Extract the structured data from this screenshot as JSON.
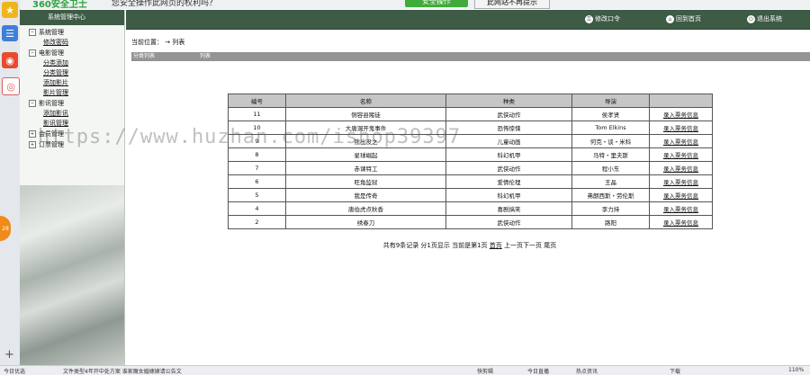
{
  "notify": {
    "logo": "360安全卫士",
    "message": "您安全操作此网页的权利吗？",
    "action_button": "安全操作",
    "dismiss_button": "此网站不再提示"
  },
  "sidebar": {
    "title": "系统管理中心",
    "groups": [
      {
        "label": "系统管理",
        "toggle": "⊟",
        "items": [
          "修改密码"
        ]
      },
      {
        "label": "电影管理",
        "toggle": "⊟",
        "items": [
          "分类添加",
          "分类管理",
          "添加影片",
          "影片管理"
        ]
      },
      {
        "label": "影讯管理",
        "toggle": "⊟",
        "items": [
          "添加影讯",
          "影讯管理"
        ]
      },
      {
        "label": "会员管理",
        "toggle": "⊞",
        "items": []
      },
      {
        "label": "订票管理",
        "toggle": "⊞",
        "items": []
      }
    ]
  },
  "topbar": {
    "change_password": "修改口令",
    "home": "回到首页",
    "logout": "退出系统"
  },
  "breadcrumb": "当前位置：  → 列表",
  "section": {
    "left": "分类列表",
    "right": "列表"
  },
  "table": {
    "headers": [
      "编号",
      "名称",
      "种类",
      "导演",
      ""
    ],
    "rows": [
      [
        "11",
        "侧容县赌徒",
        "武侠动作",
        "侯孝贤",
        "录入票务信息"
      ],
      [
        "10",
        "大唐洞开鬼事件",
        "恐怖惊悚",
        "Tom Elkins",
        "录入票务信息"
      ],
      [
        "9",
        "熊出没之",
        "儿童动画",
        "何克・谈・米科",
        "录入票务信息"
      ],
      [
        "8",
        "星球崛起",
        "科幻机甲",
        "马特・里夫斯",
        "录入票务信息"
      ],
      [
        "7",
        "赤课特工",
        "武侠动作",
        "程小东",
        "录入票务信息"
      ],
      [
        "6",
        "旺角监狱",
        "爱情伦理",
        "王晶",
        "录入票务信息"
      ],
      [
        "5",
        "我是传奇",
        "科幻机甲",
        "弗朗西斯・劳伦斯",
        "录入票务信息"
      ],
      [
        "4",
        "唐伯虎点秋香",
        "喜剧搞笑",
        "李力持",
        "录入票务信息"
      ],
      [
        "2",
        "绣春刀",
        "武侠动作",
        "路阳",
        "录入票务信息"
      ]
    ]
  },
  "pager": {
    "summary": "共有9条记录  分1页显示  当前是第1页",
    "first": "首页",
    "rest": "上一页下一页  尾页"
  },
  "watermark": "https://www.huzhan.com/ishop39397",
  "statusbar": {
    "left": "今日优选",
    "news": "文件类型4年开中处方案 谁家魔女婚嫁嫁请公告文",
    "right_items": [
      "快剪辑",
      "今日直播",
      "热点资讯",
      "下载",
      "110%"
    ]
  },
  "dock": {
    "side_badge": "28"
  },
  "colors": {
    "header_green": "#3d5b45",
    "table_header": "#c6c6c6",
    "section_bar": "#949494"
  }
}
